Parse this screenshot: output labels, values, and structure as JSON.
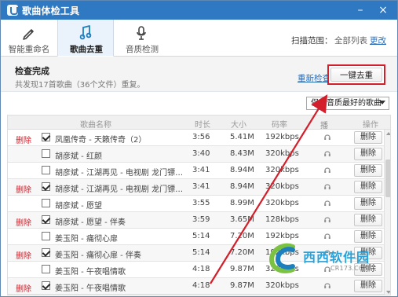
{
  "app": {
    "title": "歌曲体检工具",
    "window_controls": {
      "minimize_icon": "minimize-icon",
      "close_icon": "close-icon"
    }
  },
  "tabs": [
    {
      "id": "rename",
      "label": "智能重命名",
      "icon": "pen-icon",
      "active": false
    },
    {
      "id": "dedupe",
      "label": "歌曲去重",
      "icon": "music-note-icon",
      "active": true
    },
    {
      "id": "quality",
      "label": "音质检测",
      "icon": "microphone-icon",
      "active": false
    }
  ],
  "scan": {
    "label": "扫描范围：",
    "value": "全部列表",
    "change_label": "更改"
  },
  "status": {
    "title": "检查完成",
    "subtitle": "共发现17首歌曲（36个文件）重复。",
    "rescan_label": "重新检查",
    "one_key_label": "一键去重"
  },
  "filter": {
    "selected": "保留音质最好的歌曲"
  },
  "table": {
    "headers": {
      "name": "歌曲名称",
      "time": "时长",
      "size": "大小",
      "bitrate": "码率",
      "play": "播放",
      "op": "操作"
    },
    "rows": [
      {
        "left_delete": "删除",
        "checked": true,
        "name": "凤凰传奇 - 天籁传奇（2）",
        "time": "3:56",
        "size": "5.41M",
        "bitrate": "192kbps",
        "op_label": "删除"
      },
      {
        "left_delete": "",
        "checked": false,
        "name": "胡彦斌 - 红颜",
        "time": "3:40",
        "size": "8.43M",
        "bitrate": "320kbps",
        "op_label": "删除"
      },
      {
        "left_delete": "",
        "checked": false,
        "name": "胡彦斌 - 江湖再见 - 电视剧 龙门镖…",
        "time": "3:41",
        "size": "8.94M",
        "bitrate": "320kbps",
        "op_label": "删除"
      },
      {
        "left_delete": "删除",
        "checked": true,
        "name": "胡彦斌 - 江湖再见 - 电视剧 龙门镖…",
        "time": "3:41",
        "size": "8.94M",
        "bitrate": "320kbps",
        "op_label": "删除"
      },
      {
        "left_delete": "",
        "checked": false,
        "name": "胡彦斌 - 愿望",
        "time": "3:55",
        "size": "8.99M",
        "bitrate": "320kbps",
        "op_label": "删除"
      },
      {
        "left_delete": "删除",
        "checked": true,
        "name": "胡彦斌 - 愿望 - 伴奏",
        "time": "3:59",
        "size": "3.65M",
        "bitrate": "128kbps",
        "op_label": "删除"
      },
      {
        "left_delete": "",
        "checked": false,
        "name": "姜玉阳 - 痛彻心扉",
        "time": "5:14",
        "size": "7.20M",
        "bitrate": "192kbps",
        "op_label": "删除"
      },
      {
        "left_delete": "删除",
        "checked": true,
        "name": "姜玉阳 - 痛彻心扉 - 伴奏",
        "time": "5:14",
        "size": "7.20M",
        "bitrate": "192kbps",
        "op_label": "删除"
      },
      {
        "left_delete": "",
        "checked": false,
        "name": "姜玉阳 - 午夜唱情歌",
        "time": "4:18",
        "size": "9.87M",
        "bitrate": "320kbps",
        "op_label": "删除"
      },
      {
        "left_delete": "删除",
        "checked": true,
        "name": "姜玉阳 - 午夜唱情歌",
        "time": "4:18",
        "size": "9.87M",
        "bitrate": "320kbps",
        "op_label": "删除"
      }
    ]
  },
  "watermark": {
    "text": "西西软件园",
    "sub": "CR173.COM"
  },
  "colors": {
    "annotation_red": "#d21f2b",
    "accent_blue": "#2f78c2"
  }
}
